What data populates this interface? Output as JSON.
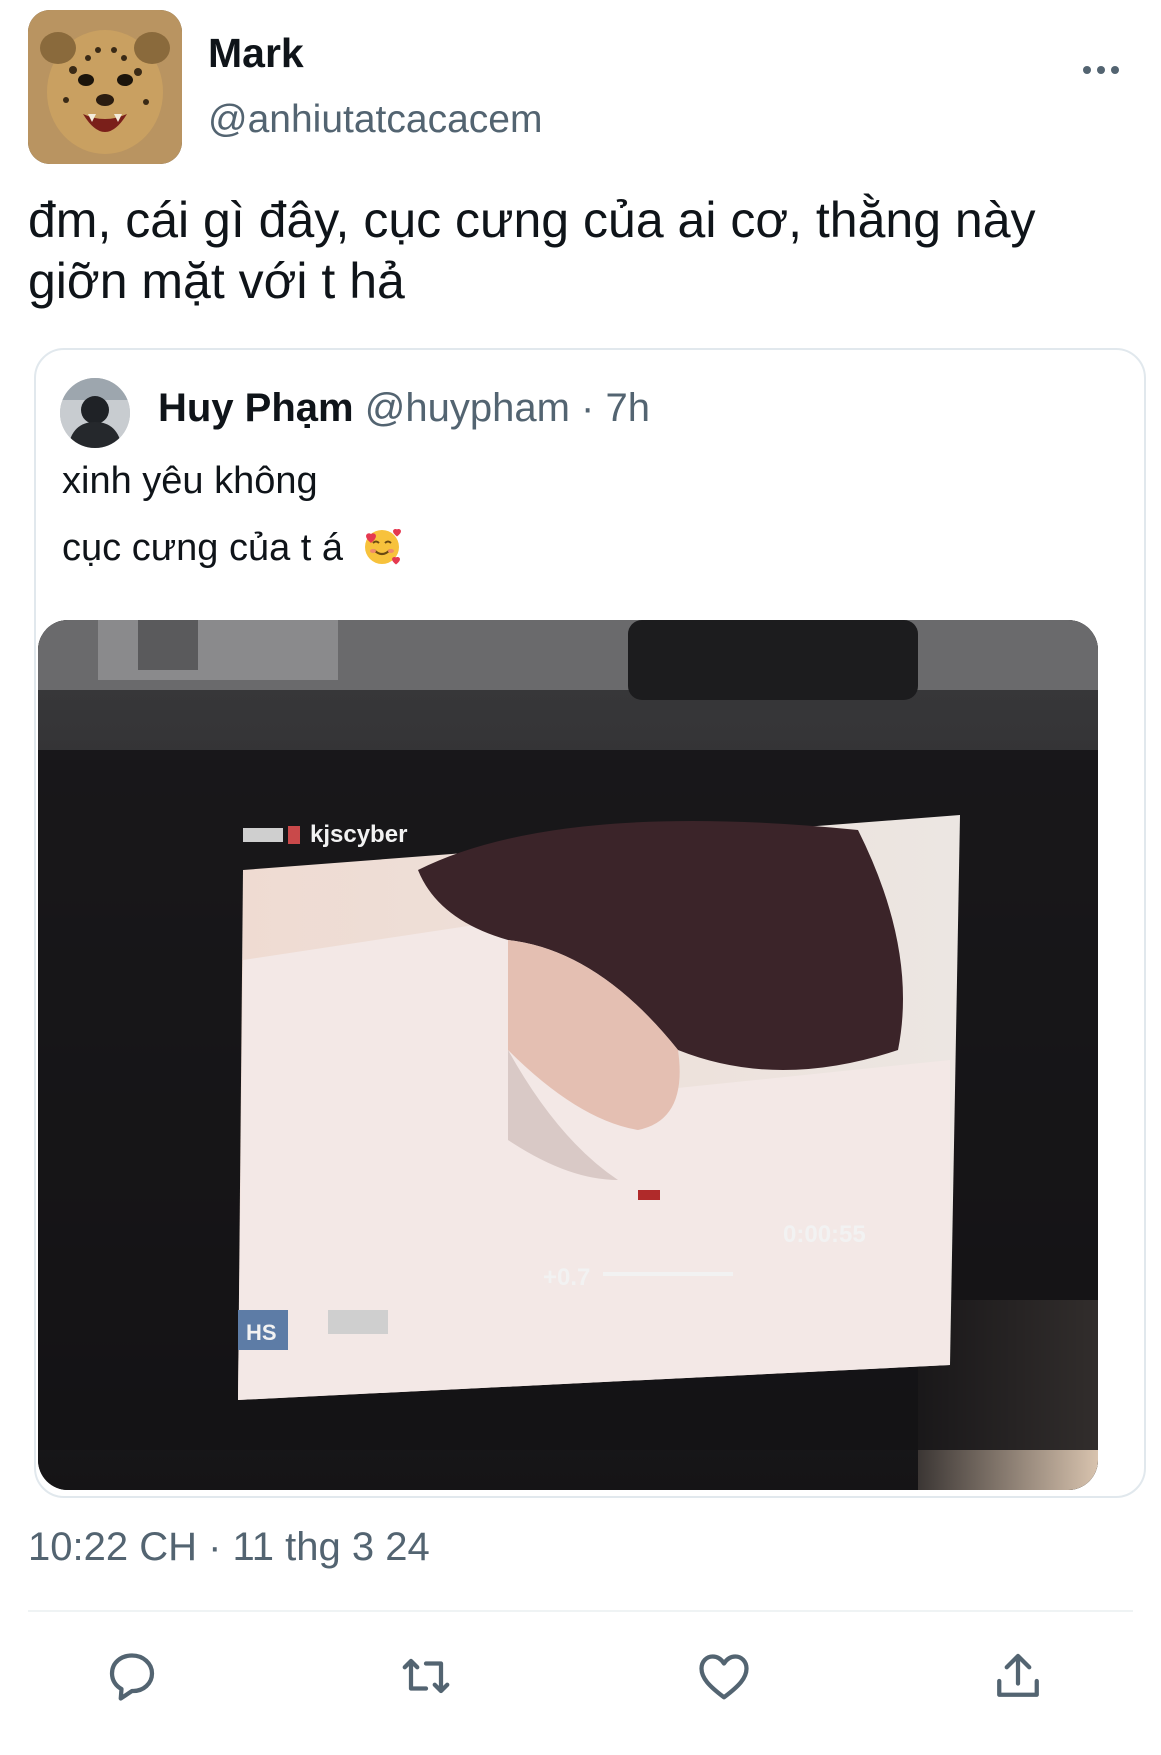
{
  "tweet": {
    "author": {
      "display_name": "Mark",
      "handle": "@anhiutatcacacem",
      "avatar_icon": "cheetah-cub-avatar"
    },
    "text": "đm, cái gì đây, cục cưng của ai cơ, thằng này giỡn mặt với t hả",
    "timestamp": "10:22 CH · 11 thg 3 24"
  },
  "quoted_tweet": {
    "author": {
      "display_name": "Huy Phạm",
      "handle": "@huypham",
      "separator": "·",
      "time_ago": "7h"
    },
    "line1": "xinh yêu không",
    "line2": "cục cưng của t á",
    "emoji": "smiling-face-with-hearts",
    "media": {
      "viewfinder_label": "kjscyber",
      "exposure": "+0.7",
      "timecode": "0:00:55",
      "mode_badge": "HS"
    }
  },
  "actions": {
    "icons": [
      "reply-icon",
      "retweet-icon",
      "like-icon",
      "share-icon"
    ]
  },
  "colors": {
    "text_primary": "#0f1419",
    "text_secondary": "#536471",
    "border": "#e1e8ed"
  }
}
